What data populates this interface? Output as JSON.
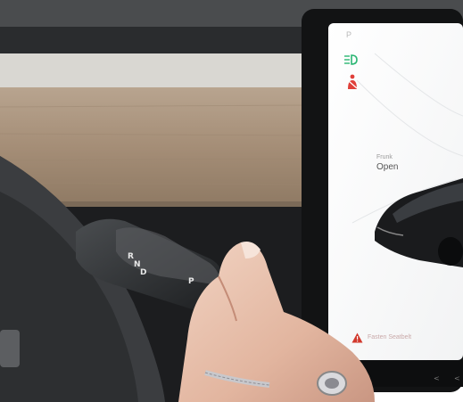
{
  "screen": {
    "gear_indicator": "P",
    "frunk_label": "Frunk",
    "frunk_status": "Open",
    "alert_text": "Fasten Seatbelt",
    "icons": {
      "headlight": "headlight-indicator-icon",
      "seatbelt": "seatbelt-warning-icon",
      "alert": "warning-triangle-icon"
    },
    "colors": {
      "headlight": "#2bb673",
      "seatbelt": "#e0403a",
      "alert": "#d23a2e"
    }
  },
  "stalk": {
    "r": "R",
    "n": "N",
    "d": "D",
    "p": "P"
  }
}
